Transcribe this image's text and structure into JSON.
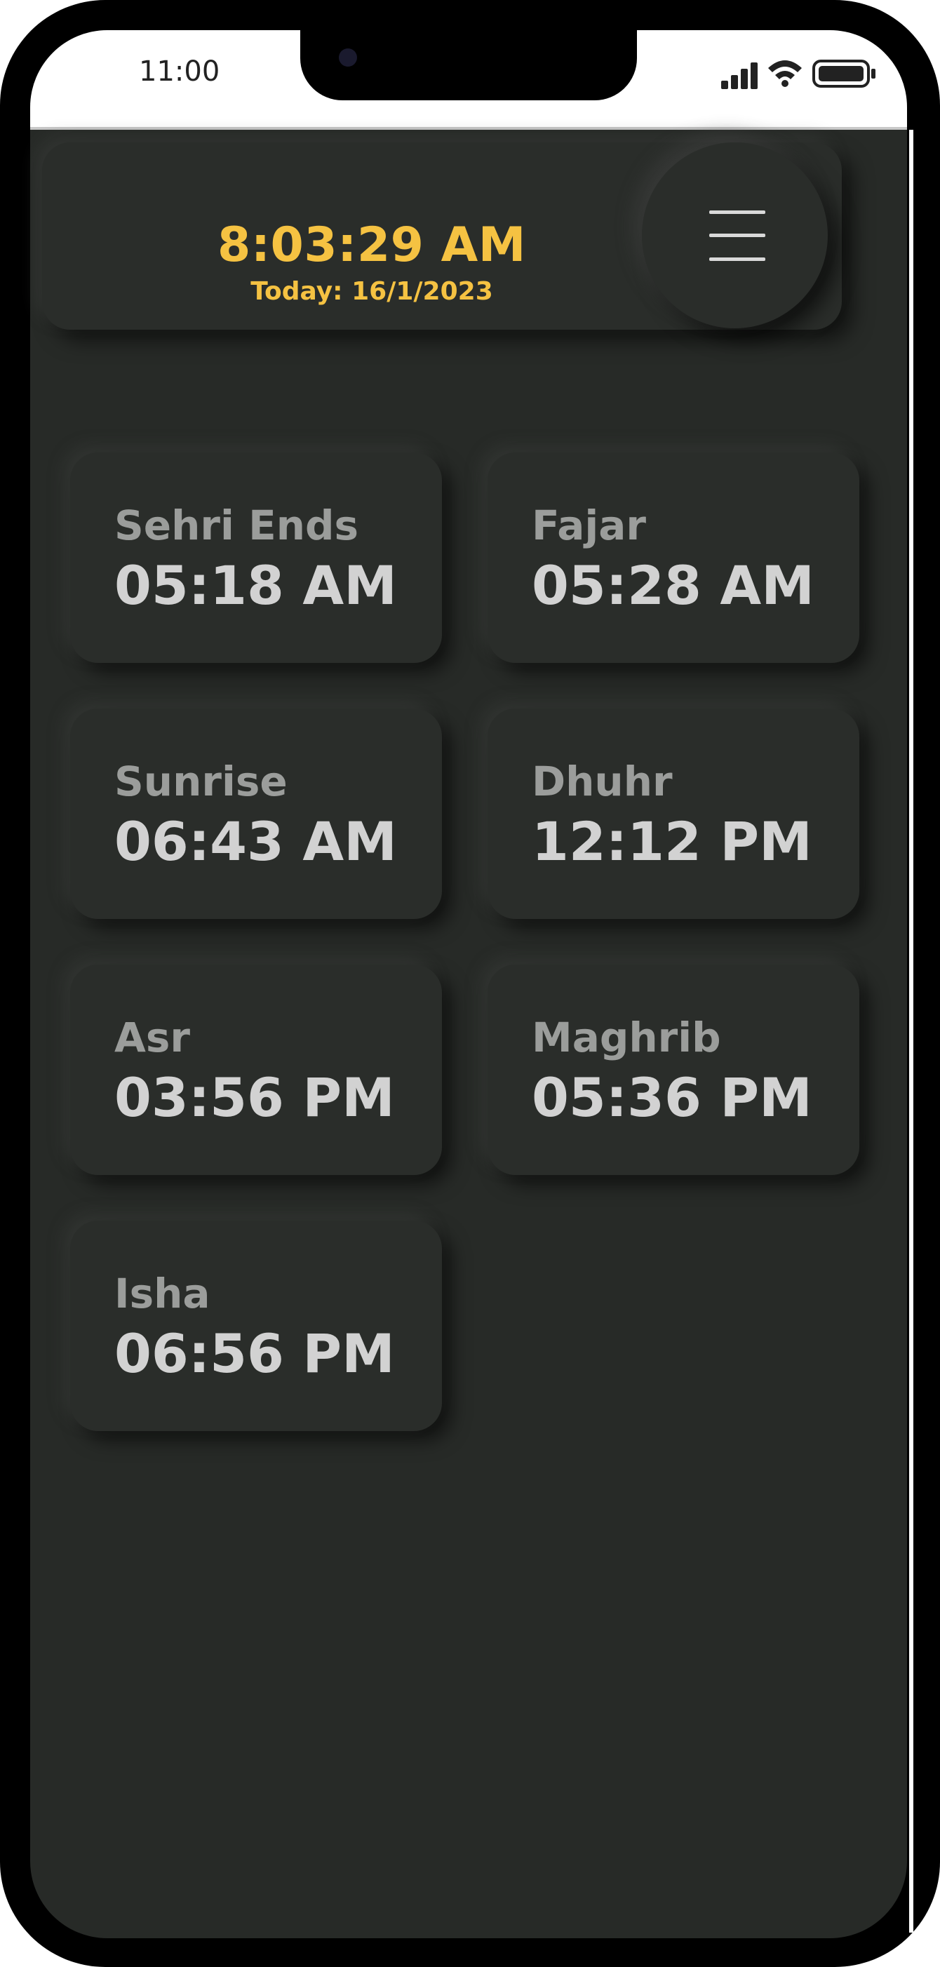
{
  "status_bar": {
    "time": "11:00",
    "icons": [
      "signal-icon",
      "wifi-icon",
      "battery-icon"
    ]
  },
  "header": {
    "clock": "8:03:29 AM",
    "date": "Today: 16/1/2023",
    "menu_icon": "hamburger-menu-icon"
  },
  "prayers": [
    {
      "name": "Sehri Ends",
      "time": "05:18 AM"
    },
    {
      "name": "Fajar",
      "time": "05:28 AM"
    },
    {
      "name": "Sunrise",
      "time": "06:43 AM"
    },
    {
      "name": "Dhuhr",
      "time": "12:12 PM"
    },
    {
      "name": "Asr",
      "time": "03:56 PM"
    },
    {
      "name": "Maghrib",
      "time": "05:36 PM"
    },
    {
      "name": "Isha",
      "time": "06:56 PM"
    }
  ],
  "colors": {
    "background": "#272a27",
    "card": "#2a2d2a",
    "accent": "#f5c242",
    "label": "#9b9d9b",
    "value": "#d2d2d2"
  }
}
